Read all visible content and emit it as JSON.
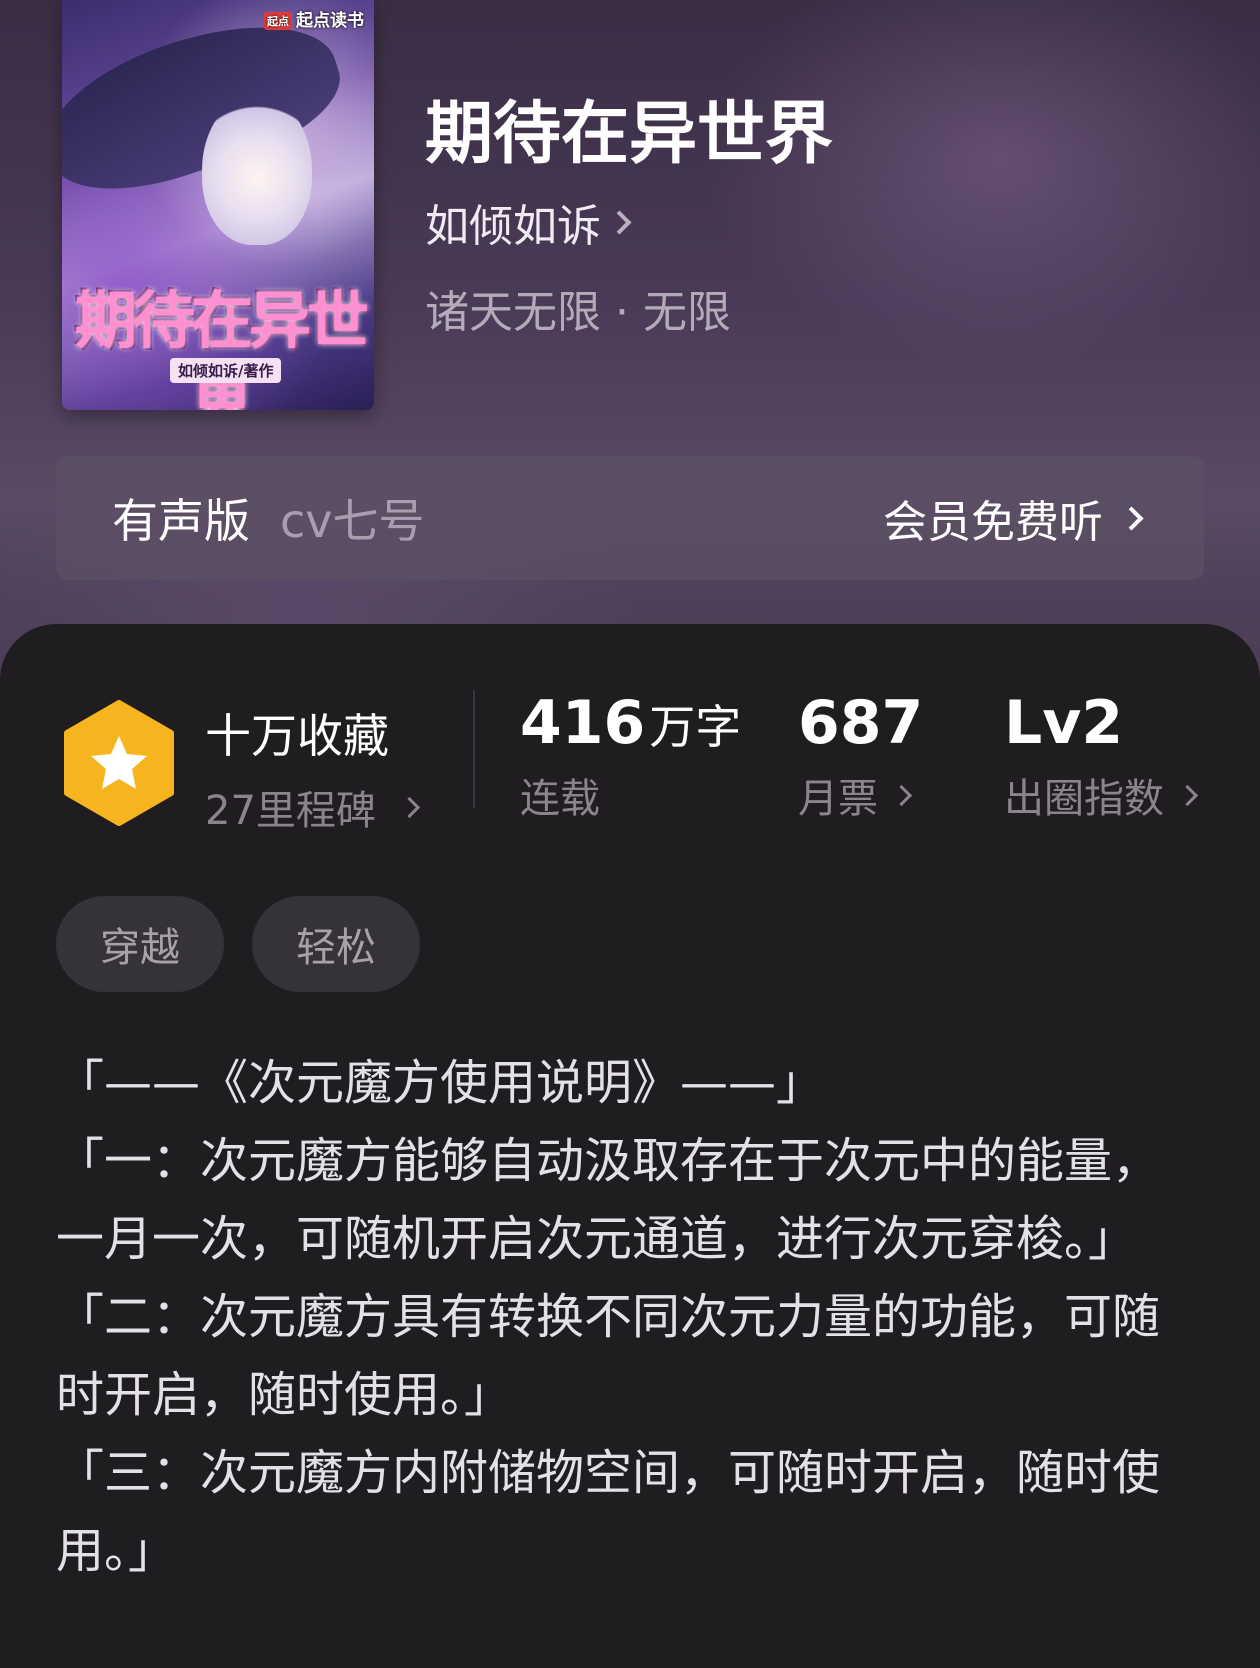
{
  "book": {
    "title": "期待在异世界",
    "author": "如倾如诉",
    "genre": "诸天无限 · 无限",
    "cover": {
      "brand_mark": "起点",
      "brand": "起点读书",
      "title": "期待在异世界",
      "author_credit": "如倾如诉/著作"
    }
  },
  "audio": {
    "label": "有声版",
    "narrator": "cv七号",
    "action": "会员免费听"
  },
  "stats": {
    "collection": {
      "title": "十万收藏",
      "subtitle": "27里程碑"
    },
    "words": {
      "value": "416",
      "unit": "万字",
      "label": "连载"
    },
    "monthly_votes": {
      "value": "687",
      "label": "月票"
    },
    "influence": {
      "value": "Lv2",
      "label": "出圈指数"
    }
  },
  "tags": [
    "穿越",
    "轻松"
  ],
  "description": [
    "「——《次元魔方使用说明》——」",
    "「一：次元魔方能够自动汲取存在于次元中的能量，一月一次，可随机开启次元通道，进行次元穿梭。」",
    "「二：次元魔方具有转换不同次元力量的功能，可随时开启，随时使用。」",
    "「三：次元魔方内附储物空间，可随时开启，随时使用。」"
  ],
  "colors": {
    "badge": "#f6b51e",
    "panel": "#1f1d20",
    "header": "#4a3a56"
  },
  "icons": {
    "badge": "star-badge-icon",
    "chevron": "chevron-right-icon"
  }
}
